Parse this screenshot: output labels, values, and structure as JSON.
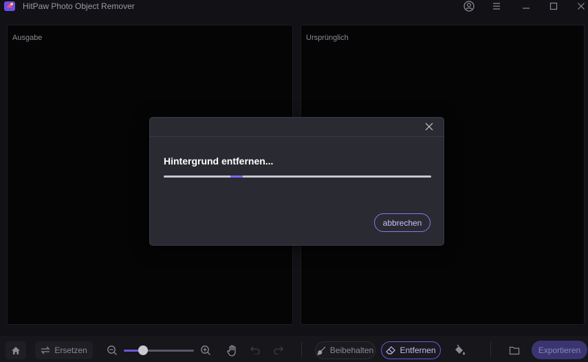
{
  "app": {
    "title": "HitPaw Photo Object Remover"
  },
  "titlebar": {
    "account_icon": "user-circle-icon",
    "menu_icon": "hamburger-menu-icon",
    "minimize_icon": "minimize-icon",
    "maximize_icon": "maximize-icon",
    "close_icon": "close-icon"
  },
  "panels": {
    "output_label": "Ausgabe",
    "original_label": "Ursprünglich"
  },
  "dialog": {
    "title": "Hintergrund entfernen...",
    "cancel_label": "abbrechen",
    "progress_fraction": 0.25
  },
  "toolbar": {
    "replace_label": "Ersetzen",
    "zoom_level": 0.27,
    "keep_label": "Beibehalten",
    "remove_label": "Entfernen",
    "export_label": "Exportieren"
  },
  "colors": {
    "accent": "#7c6cf0",
    "background": "#121216",
    "dialog": "#2a2a33"
  }
}
